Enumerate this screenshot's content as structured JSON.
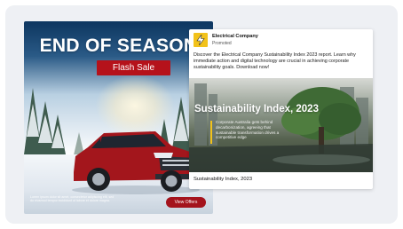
{
  "car_ad": {
    "headline": "END OF SEASON",
    "badge": "Flash Sale",
    "disclaimer": "Lorem ipsum dolor sit amet, consectetur adipiscing elit, sed do eiusmod tempor incididunt ut labore et dolore magna.",
    "cta_label": "View Offers",
    "colors": {
      "badge": "#b5121b",
      "cta": "#a4131c",
      "car": "#a3161c"
    }
  },
  "post": {
    "company_name": "Electrical Company",
    "sponsor_label": "Promoted",
    "logo_icon": "lightning-bolt-icon",
    "body": "Discover the Electrical Company Sustainability Index 2023 report. Learn why immediate action and digital technology are crucial in achieving corporate sustainability goals. Download now!",
    "hero": {
      "title": "Sustainability Index, 2023",
      "description": "Corporate Australia gets behind decarbonization, agreeing that sustainable transformation drives a competitive edge"
    },
    "caption": "Sustainability Index, 2023",
    "colors": {
      "logo": "#f2c21b",
      "accent": "#f2c21b"
    }
  }
}
